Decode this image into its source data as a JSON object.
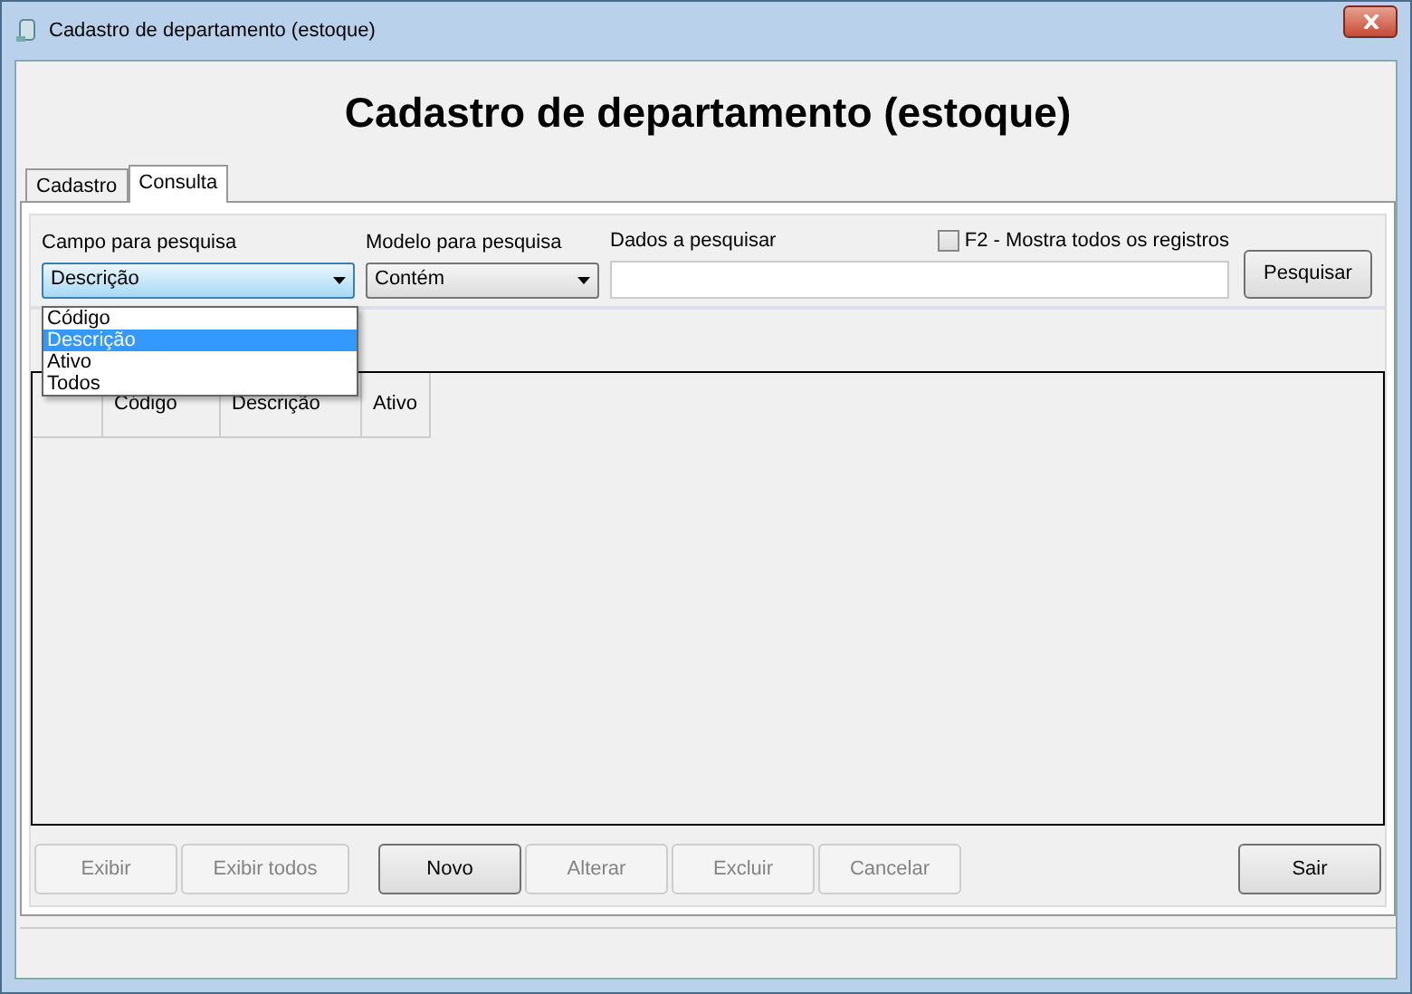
{
  "window": {
    "title": "Cadastro de departamento (estoque)"
  },
  "heading": "Cadastro de departamento (estoque)",
  "tabs": [
    {
      "label": "Cadastro",
      "selected": false
    },
    {
      "label": "Consulta",
      "selected": true
    }
  ],
  "search": {
    "field_label": "Campo para pesquisa",
    "field_value": "Descrição",
    "model_label": "Modelo para pesquisa",
    "model_value": "Contém",
    "data_label": "Dados a pesquisar",
    "show_all": {
      "label": "F2 - Mostra todos os registros",
      "checked": false
    },
    "search_button": "Pesquisar",
    "dropdown": {
      "expanded": true,
      "options": [
        {
          "label": "Código",
          "selected": false
        },
        {
          "label": "Descrição",
          "selected": true
        },
        {
          "label": "Ativo",
          "selected": false
        },
        {
          "label": "Todos",
          "selected": false
        }
      ]
    }
  },
  "table": {
    "columns": [
      "Código",
      "Descrição",
      "Ativo"
    ]
  },
  "buttons": [
    {
      "label": "Exibir",
      "disabled": true,
      "kind": "view"
    },
    {
      "label": "Exibir todos",
      "disabled": true,
      "kind": "view"
    },
    {
      "label": "Novo",
      "disabled": false,
      "kind": "edit"
    },
    {
      "label": "Alterar",
      "disabled": true,
      "kind": "edit"
    },
    {
      "label": "Excluir",
      "disabled": true,
      "kind": "edit"
    },
    {
      "label": "Cancelar",
      "disabled": true,
      "kind": "edit"
    },
    {
      "label": "Sair",
      "disabled": false,
      "kind": "exit"
    }
  ]
}
